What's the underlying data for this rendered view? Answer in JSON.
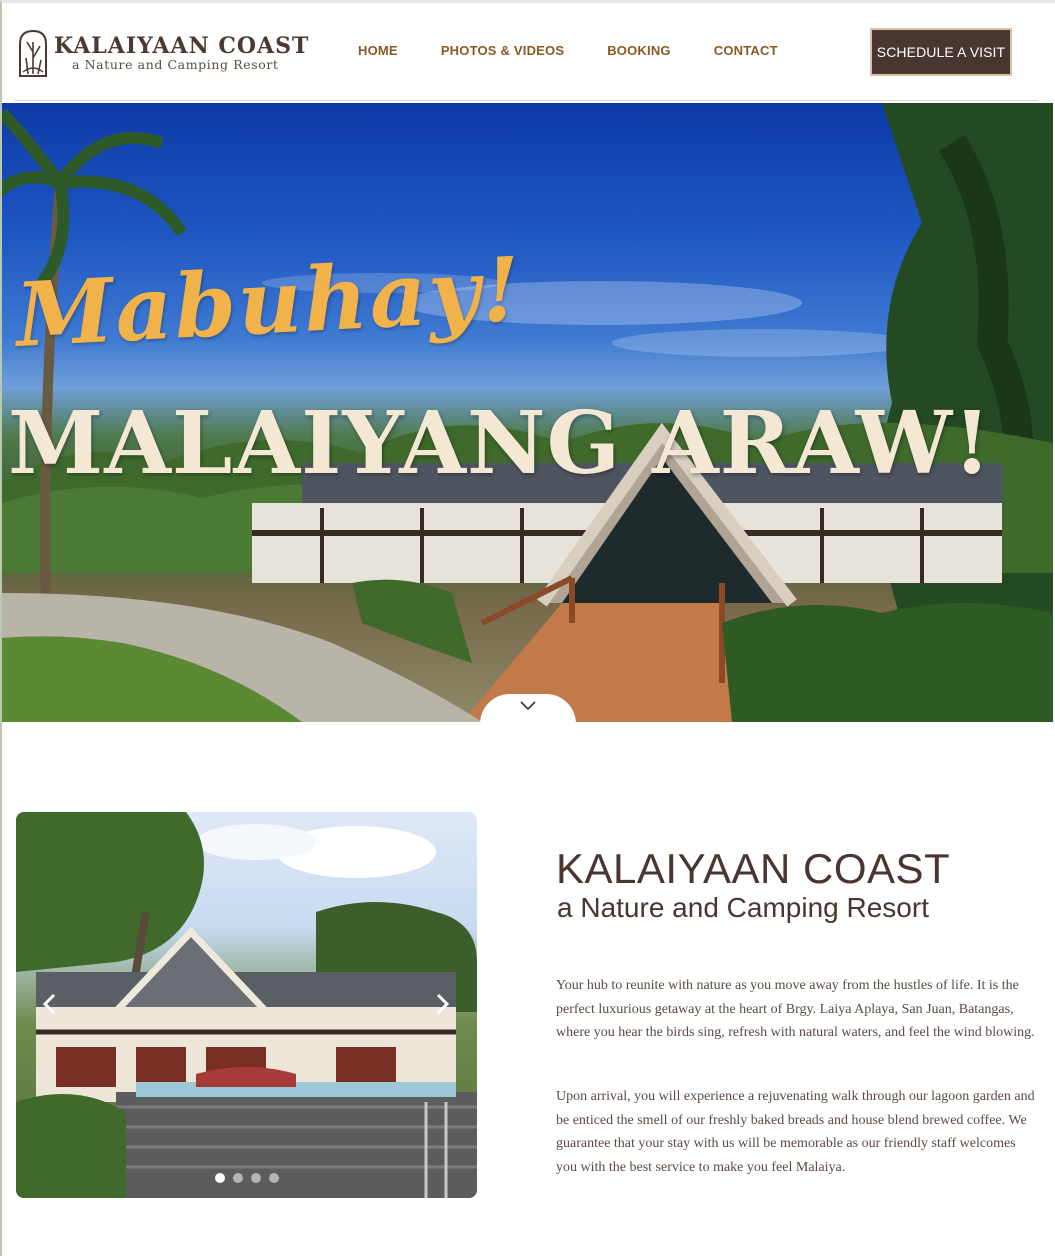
{
  "header": {
    "logo_title": "KALAIYAAN COAST",
    "logo_subtitle": "a Nature and Camping Resort",
    "nav": [
      "HOME",
      "PHOTOS & VIDEOS",
      "BOOKING",
      "CONTACT"
    ],
    "cta_label": "SCHEDULE A VISIT"
  },
  "hero": {
    "script_text": "Mabuhay!",
    "title": "MALAIYANG ARAW!",
    "scroll_icon": "chevron-down-icon"
  },
  "carousel": {
    "prev_icon": "chevron-left-icon",
    "next_icon": "chevron-right-icon",
    "slide_count": 4,
    "active_slide": 1
  },
  "about": {
    "title": "KALAIYAAN COAST",
    "subtitle": "a Nature and Camping Resort",
    "paragraphs": [
      "Your hub to reunite with nature as you move away from the hustles of life. It is the perfect luxurious getaway at the heart of Brgy. Laiya Aplaya, San Juan, Batangas, where you hear the birds sing, refresh with natural waters, and feel the wind blowing.",
      "Upon arrival, you will experience a rejuvenating walk through our lagoon garden and be enticed the smell of our freshly baked breads and house blend brewed coffee. We guarantee that your stay with us will be memorable as our friendly staff welcomes you with the best service to make you feel Malaiya."
    ]
  },
  "colors": {
    "brand_brown": "#4a3630",
    "nav_gold": "#8a5a22",
    "script_yellow": "#f2b24a",
    "hero_cream": "#f4e8d4"
  }
}
